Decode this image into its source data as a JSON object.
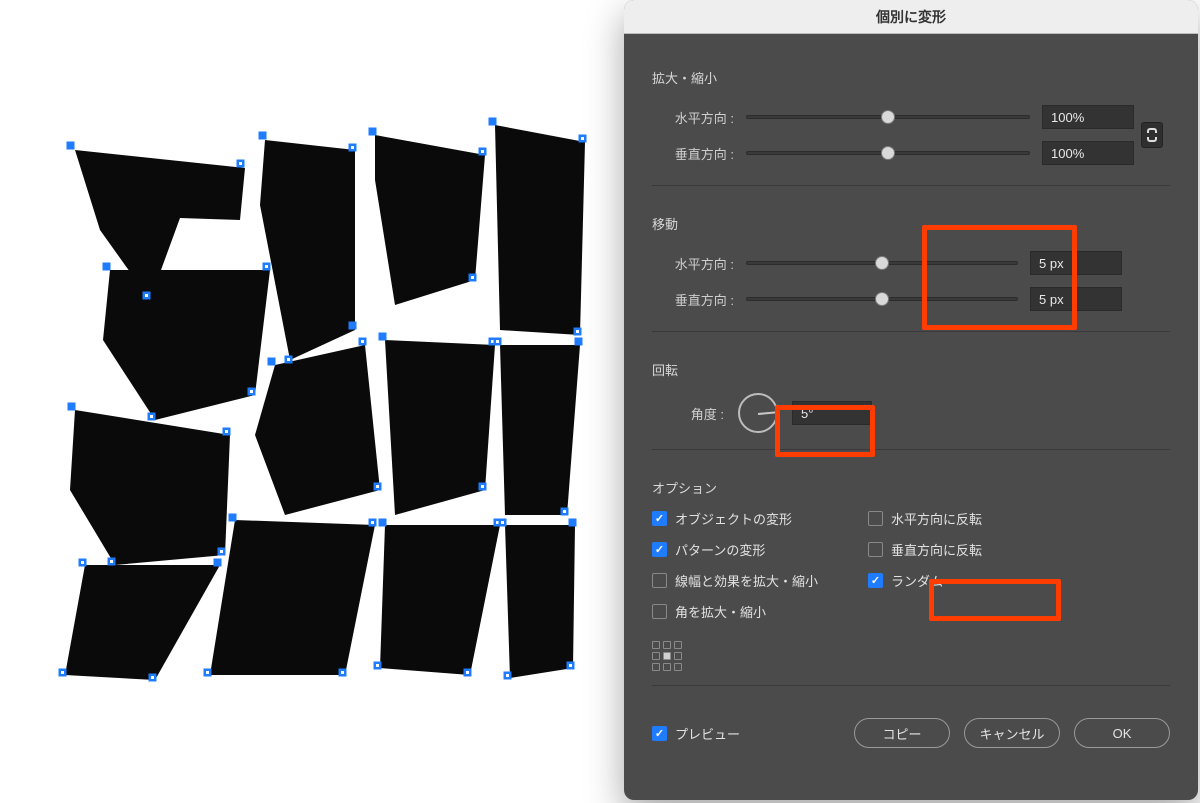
{
  "dialog": {
    "title": "個別に変形",
    "scale": {
      "section_label": "拡大・縮小",
      "h_label": "水平方向 :",
      "h_value": "100%",
      "v_label": "垂直方向 :",
      "v_value": "100%"
    },
    "move": {
      "section_label": "移動",
      "h_label": "水平方向 :",
      "h_value": "5 px",
      "v_label": "垂直方向 :",
      "v_value": "5 px"
    },
    "rotate": {
      "section_label": "回転",
      "angle_label": "角度 :",
      "angle_value": "5°"
    },
    "options": {
      "section_label": "オプション",
      "transform_objects": "オブジェクトの変形",
      "transform_patterns": "パターンの変形",
      "scale_strokes": "線幅と効果を拡大・縮小",
      "scale_corners": "角を拡大・縮小",
      "reflect_x": "水平方向に反転",
      "reflect_y": "垂直方向に反転",
      "random": "ランダム"
    },
    "footer": {
      "preview_label": "プレビュー",
      "copy_label": "コピー",
      "cancel_label": "キャンセル",
      "ok_label": "OK"
    }
  },
  "colors": {
    "accent": "#1f7cff",
    "highlight_box": "#ff3d00",
    "panel": "#4b4b4b"
  }
}
